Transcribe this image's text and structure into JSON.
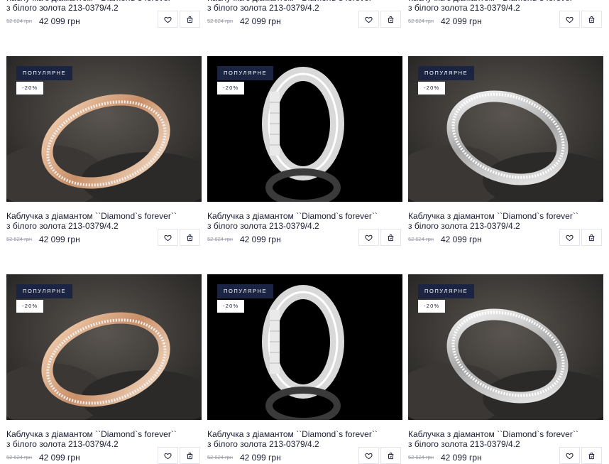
{
  "badges": {
    "popular": "ПОПУЛЯРНЕ",
    "discount": "-20%"
  },
  "products": [
    {
      "title_line1": "Каблучка з діамантом ``Diamond`s forever``",
      "title_line2": "з білого золота 213-0379/4.2",
      "old_price": "52 624 грн",
      "price": "42 099 грн",
      "image": "gold-white-ring-on-coal"
    },
    {
      "title_line1": "Каблучка з діамантом ``Diamond`s forever``",
      "title_line2": "з білого золота 213-0379/4.2",
      "old_price": "52 624 грн",
      "price": "42 099 грн",
      "image": "white-ring-black-background"
    },
    {
      "title_line1": "Каблучка з діамантом ``Diamond`s forever``",
      "title_line2": "з білого золота 213-0379/4.2",
      "old_price": "52 624 грн",
      "price": "42 099 грн",
      "image": "white-ring-on-coal"
    },
    {
      "title_line1": "Каблучка з діамантом ``Diamond`s forever``",
      "title_line2": "з білого золота 213-0379/4.2",
      "old_price": "52 624 грн",
      "price": "42 099 грн",
      "image": "gold-white-ring-on-coal"
    },
    {
      "title_line1": "Каблучка з діамантом ``Diamond`s forever``",
      "title_line2": "з білого золота 213-0379/4.2",
      "old_price": "52 624 грн",
      "price": "42 099 грн",
      "image": "white-ring-black-background"
    },
    {
      "title_line1": "Каблучка з діамантом ``Diamond`s forever``",
      "title_line2": "з білого золота 213-0379/4.2",
      "old_price": "52 624 грн",
      "price": "42 099 грн",
      "image": "white-ring-on-coal"
    },
    {
      "title_line1": "Каблучка з діамантом ``Diamond`s forever``",
      "title_line2": "з білого золота 213-0379/4.2",
      "old_price": "52 624 грн",
      "price": "42 099 грн",
      "image": "gold-white-ring-on-coal"
    },
    {
      "title_line1": "Каблучка з діамантом ``Diamond`s forever``",
      "title_line2": "з білого золота 213-0379/4.2",
      "old_price": "52 624 грн",
      "price": "42 099 грн",
      "image": "white-ring-black-background"
    },
    {
      "title_line1": "Каблучка з діамантом ``Diamond`s forever``",
      "title_line2": "з білого золота 213-0379/4.2",
      "old_price": "52 624 грн",
      "price": "42 099 грн",
      "image": "white-ring-on-coal"
    }
  ],
  "icons": {
    "wishlist": "heart-icon",
    "cart": "shopping-bag-icon"
  },
  "colors": {
    "badge_bg": "#1b2543",
    "text": "#1a1d33",
    "old_price": "#9a9ca6",
    "border": "#e4e5ea"
  }
}
